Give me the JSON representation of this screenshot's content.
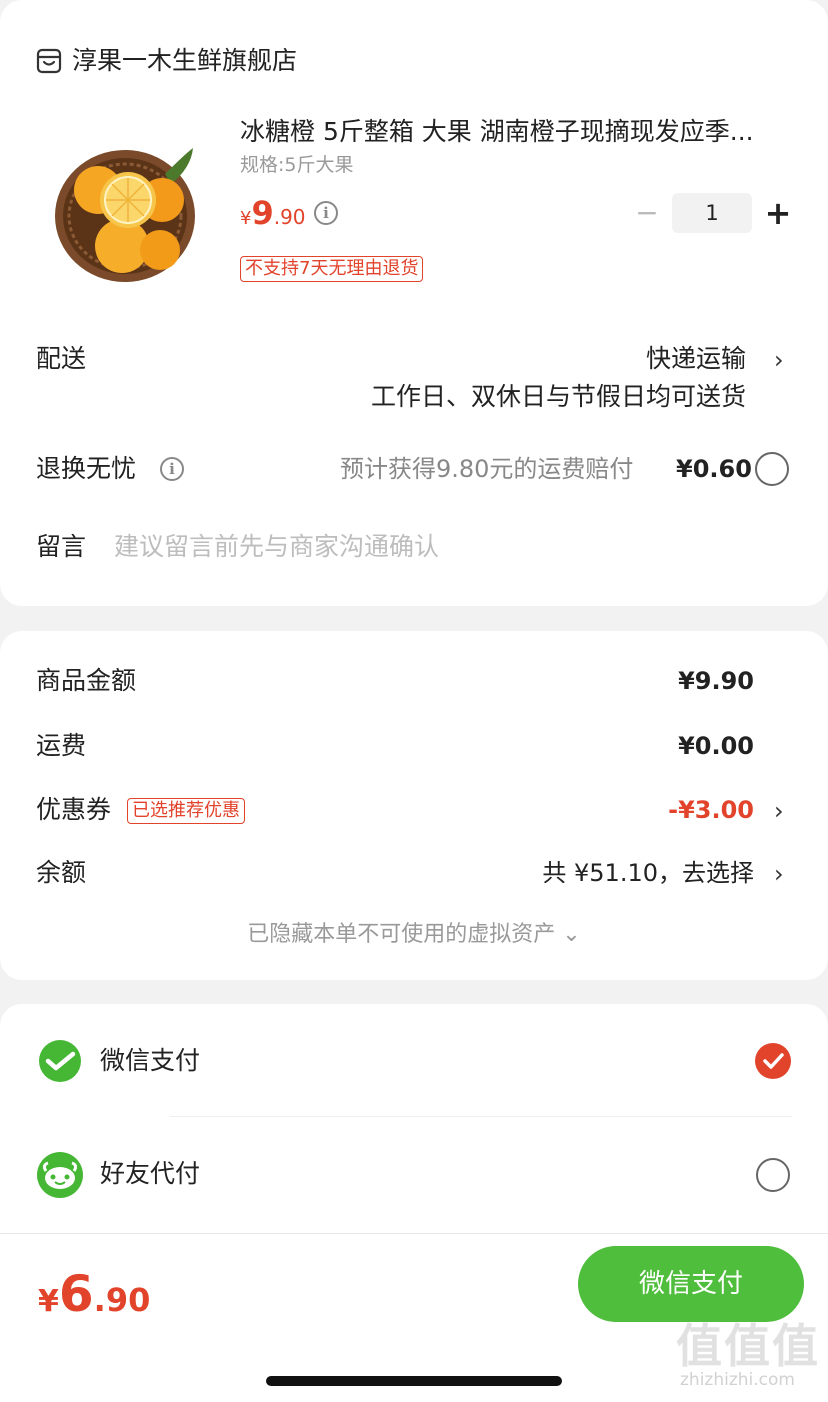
{
  "shop": {
    "name": "淳果一木生鲜旗舰店",
    "icon": "store-icon"
  },
  "product": {
    "title": "冰糖橙 5斤整箱 大果 湖南橙子现摘现发应季...",
    "spec": "规格:5斤大果",
    "currency": "¥",
    "price_int": "9",
    "price_dec": ".90",
    "quantity": "1",
    "no_return_tag": "不支持7天无理由退货",
    "minus": "−",
    "plus": "+"
  },
  "delivery": {
    "label": "配送",
    "method": "快递运输",
    "note": "工作日、双休日与节假日均可送货"
  },
  "return_worry": {
    "label": "退换无忧",
    "desc": "预计获得9.80元的运费赔付",
    "price": "¥0.60"
  },
  "message": {
    "label": "留言",
    "placeholder": "建议留言前先与商家沟通确认"
  },
  "summary": {
    "goods_label": "商品金额",
    "goods_value": "¥9.90",
    "shipping_label": "运费",
    "shipping_value": "¥0.00",
    "coupon_label": "优惠券",
    "coupon_tag": "已选推荐优惠",
    "coupon_value": "-¥3.00",
    "balance_label": "余额",
    "balance_value": "共 ¥51.10，去选择",
    "hidden_note": "已隐藏本单不可使用的虚拟资产 ⌄"
  },
  "payment": {
    "wechat_label": "微信支付",
    "friend_label": "好友代付",
    "selected": "wechat"
  },
  "footer": {
    "currency": "¥",
    "total_int": "6",
    "total_dec": ".90",
    "pay_button": "微信支付"
  },
  "watermark": {
    "text": "值值值",
    "url": "zhizhizhi.com"
  },
  "colors": {
    "accent_red": "#e2432b",
    "wechat_green": "#46b734",
    "button_green": "#4fbe3c"
  }
}
